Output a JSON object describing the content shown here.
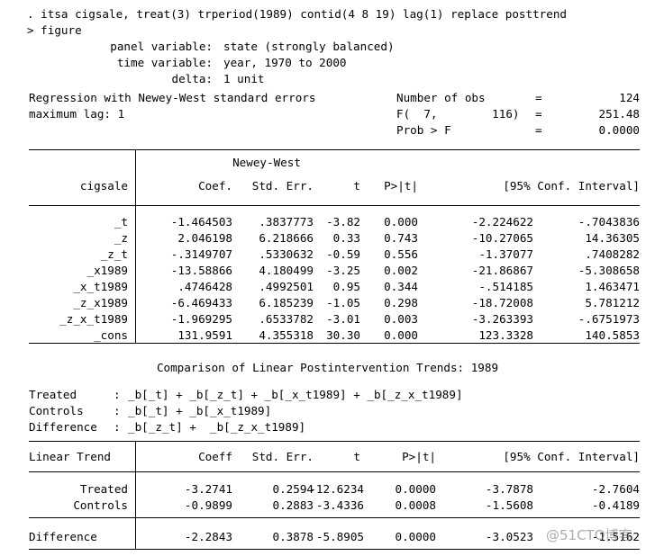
{
  "command": {
    "prompt": ". itsa cigsale, treat(3) trperiod(1989) contid(4 8 19) lag(1) replace posttrend",
    "continuation": "> figure"
  },
  "panel_info": {
    "panel_variable_label": "panel variable:",
    "panel_variable_value": "state (strongly balanced)",
    "time_variable_label": "time variable:",
    "time_variable_value": "year, 1970 to 2000",
    "delta_label": "delta:",
    "delta_value": "1 unit"
  },
  "model_header": {
    "title": "Regression with Newey-West standard errors",
    "maxlag": "maximum lag: 1",
    "stats": [
      {
        "label": "Number of obs",
        "eq": "=",
        "value": "124"
      },
      {
        "label": "F(  7,        116)",
        "eq": "=",
        "value": "251.48"
      },
      {
        "label": "Prob > F",
        "eq": "=",
        "value": "0.0000"
      }
    ]
  },
  "main_table": {
    "dep_var": "cigsale",
    "super_header": "Newey-West",
    "columns": [
      "Coef.",
      "Std. Err.",
      "t",
      "P>|t|",
      "[95% Conf. Interval]"
    ],
    "rows": [
      {
        "name": "_t",
        "coef": "-1.464503",
        "se": ".3837773",
        "t": "-3.82",
        "p": "0.000",
        "ci_low": "-2.224622",
        "ci_high": "-.7043836"
      },
      {
        "name": "_z",
        "coef": "2.046198",
        "se": "6.218666",
        "t": "0.33",
        "p": "0.743",
        "ci_low": "-10.27065",
        "ci_high": "14.36305"
      },
      {
        "name": "_z_t",
        "coef": "-.3149707",
        "se": ".5330632",
        "t": "-0.59",
        "p": "0.556",
        "ci_low": "-1.37077",
        "ci_high": ".7408282"
      },
      {
        "name": "_x1989",
        "coef": "-13.58866",
        "se": "4.180499",
        "t": "-3.25",
        "p": "0.002",
        "ci_low": "-21.86867",
        "ci_high": "-5.308658"
      },
      {
        "name": "_x_t1989",
        "coef": ".4746428",
        "se": ".4992501",
        "t": "0.95",
        "p": "0.344",
        "ci_low": "-.514185",
        "ci_high": "1.463471"
      },
      {
        "name": "_z_x1989",
        "coef": "-6.469433",
        "se": "6.185239",
        "t": "-1.05",
        "p": "0.298",
        "ci_low": "-18.72008",
        "ci_high": "5.781212"
      },
      {
        "name": "_z_x_t1989",
        "coef": "-1.969295",
        "se": ".6533782",
        "t": "-3.01",
        "p": "0.003",
        "ci_low": "-3.263393",
        "ci_high": "-.6751973"
      },
      {
        "name": "_cons",
        "coef": "131.9591",
        "se": "4.355318",
        "t": "30.30",
        "p": "0.000",
        "ci_low": "123.3328",
        "ci_high": "140.5853"
      }
    ]
  },
  "comparison": {
    "title": "Comparison of Linear Postintervention Trends: 1989",
    "definitions": [
      {
        "label": "Treated   ",
        "sep": ":",
        "expr": "_b[_t] + _b[_z_t] + _b[_x_t1989] + _b[_z_x_t1989]"
      },
      {
        "label": "Controls  ",
        "sep": ":",
        "expr": "_b[_t] + _b[_x_t1989]"
      },
      {
        "label": "Difference",
        "sep": ":",
        "expr": "_b[_z_t] +  _b[_z_x_t1989]"
      }
    ]
  },
  "trend_table": {
    "row_header": "Linear Trend",
    "columns": [
      "Coeff",
      "Std. Err.",
      "t",
      "P>|t|",
      "[95% Conf. Interval]"
    ],
    "rows": [
      {
        "name": "Treated",
        "coef": "-3.2741",
        "se": "0.2594",
        "t": "-12.6234",
        "p": "0.0000",
        "ci_low": "-3.7878",
        "ci_high": "-2.7604"
      },
      {
        "name": "Controls",
        "coef": "-0.9899",
        "se": "0.2883",
        "t": "-3.4336",
        "p": "0.0008",
        "ci_low": "-1.5608",
        "ci_high": "-0.4189"
      }
    ],
    "difference_row": {
      "name": "Difference",
      "coef": "-2.2843",
      "se": "0.3878",
      "t": "-5.8905",
      "p": "0.0000",
      "ci_low": "-3.0523",
      "ci_high": "-1.5162"
    }
  },
  "watermark": {
    "text": "@51CTO博客"
  }
}
